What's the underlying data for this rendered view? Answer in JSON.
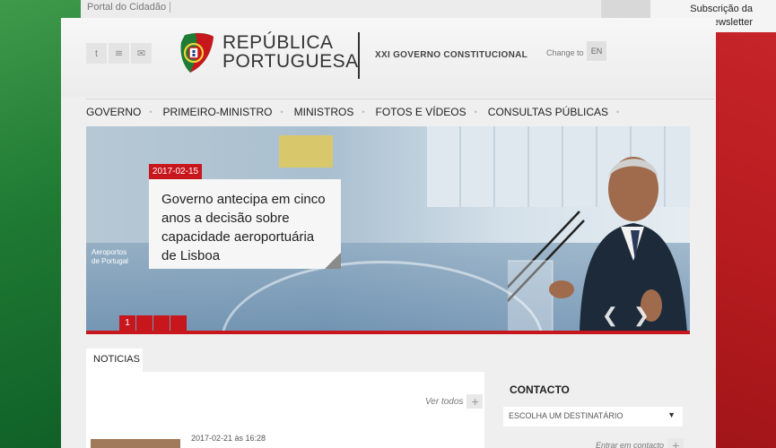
{
  "top": {
    "portal_link": "Portal do Cidadão",
    "newsletter_line1": "Subscrição da",
    "newsletter_line2": "Newsletter"
  },
  "header": {
    "social": [
      {
        "icon": "twitter-icon",
        "glyph": "t"
      },
      {
        "icon": "rss-icon",
        "glyph": "≋"
      },
      {
        "icon": "mail-icon",
        "glyph": "✉"
      }
    ],
    "logo_line1": "REPÚBLICA",
    "logo_line2": "PORTUGUESA",
    "gov_title": "XXI GOVERNO CONSTITUCIONAL",
    "change_to": "Change to",
    "lang": "EN"
  },
  "nav": {
    "items": [
      "GOVERNO",
      "PRIMEIRO-MINISTRO",
      "MINISTROS",
      "FOTOS E VÍDEOS",
      "CONSULTAS PÚBLICAS"
    ]
  },
  "hero": {
    "date": "2017-02-15",
    "caption": "Governo antecipa em cinco anos a decisão sobre capacidade aeroportuária de Lisboa",
    "airport_line1": "Aeroportos",
    "airport_line2": "de Portugal",
    "page": "1",
    "prev_glyph": "❮",
    "next_glyph": "❯"
  },
  "news": {
    "tab": "NOTICIAS",
    "see_all": "Ver todos",
    "plus": "+",
    "item_date": "2017-02-21 às 16:28"
  },
  "contact": {
    "title": "CONTACTO",
    "select_value": "ESCOLHA UM DESTINATÁRIO",
    "caret": "❤",
    "enter": "Entrar em contacto"
  },
  "colors": {
    "accent_red": "#c8161d",
    "flag_green": "#1f7a33"
  }
}
